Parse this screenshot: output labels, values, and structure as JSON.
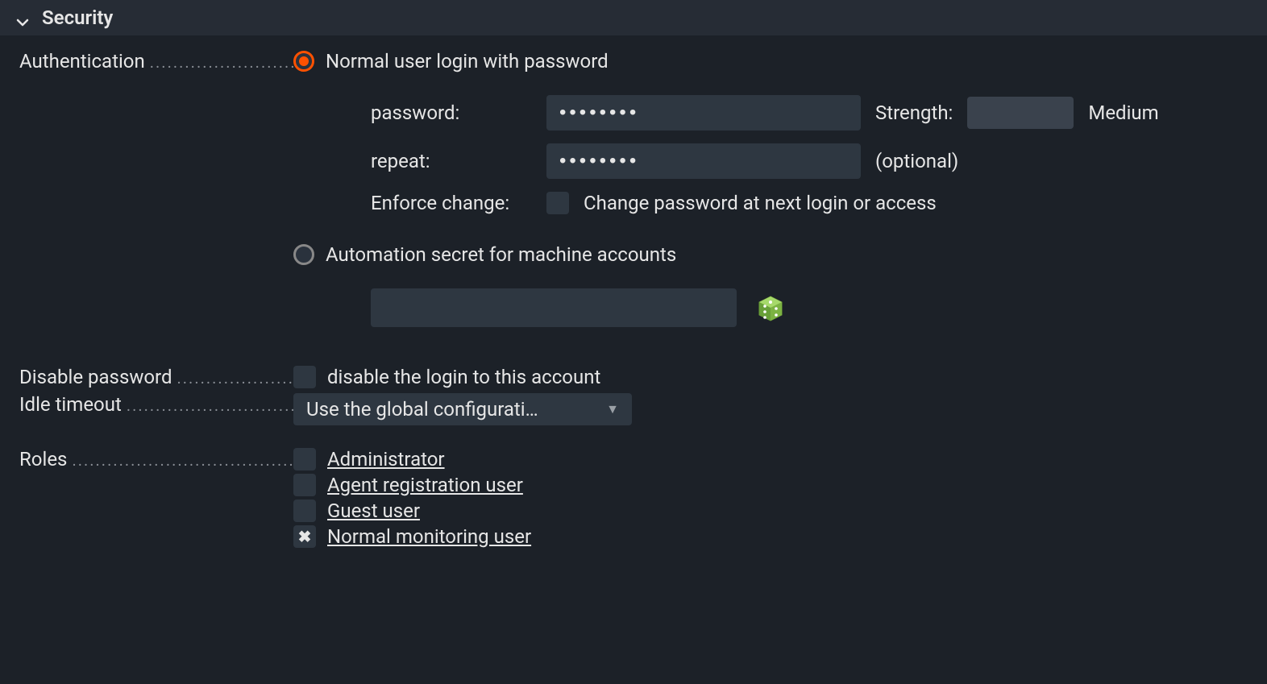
{
  "section": {
    "title": "Security"
  },
  "fields": {
    "authentication": {
      "label": "Authentication",
      "option_password": "Normal user login with password",
      "option_automation": "Automation secret for machine accounts",
      "password_label": "password:",
      "password_value": "••••••••",
      "repeat_label": "repeat:",
      "repeat_value": "••••••••",
      "repeat_hint": "(optional)",
      "strength_label": "Strength:",
      "strength_text": "Medium",
      "enforce_label": "Enforce change:",
      "enforce_text": "Change password at next login or access"
    },
    "disable_password": {
      "label": "Disable password",
      "text": "disable the login to this account"
    },
    "idle_timeout": {
      "label": "Idle timeout",
      "value": "Use the global configurati…"
    },
    "roles": {
      "label": "Roles",
      "items": [
        {
          "label": "Administrator",
          "checked": false
        },
        {
          "label": "Agent registration user",
          "checked": false
        },
        {
          "label": "Guest user",
          "checked": false
        },
        {
          "label": "Normal monitoring user",
          "checked": true
        }
      ]
    }
  }
}
